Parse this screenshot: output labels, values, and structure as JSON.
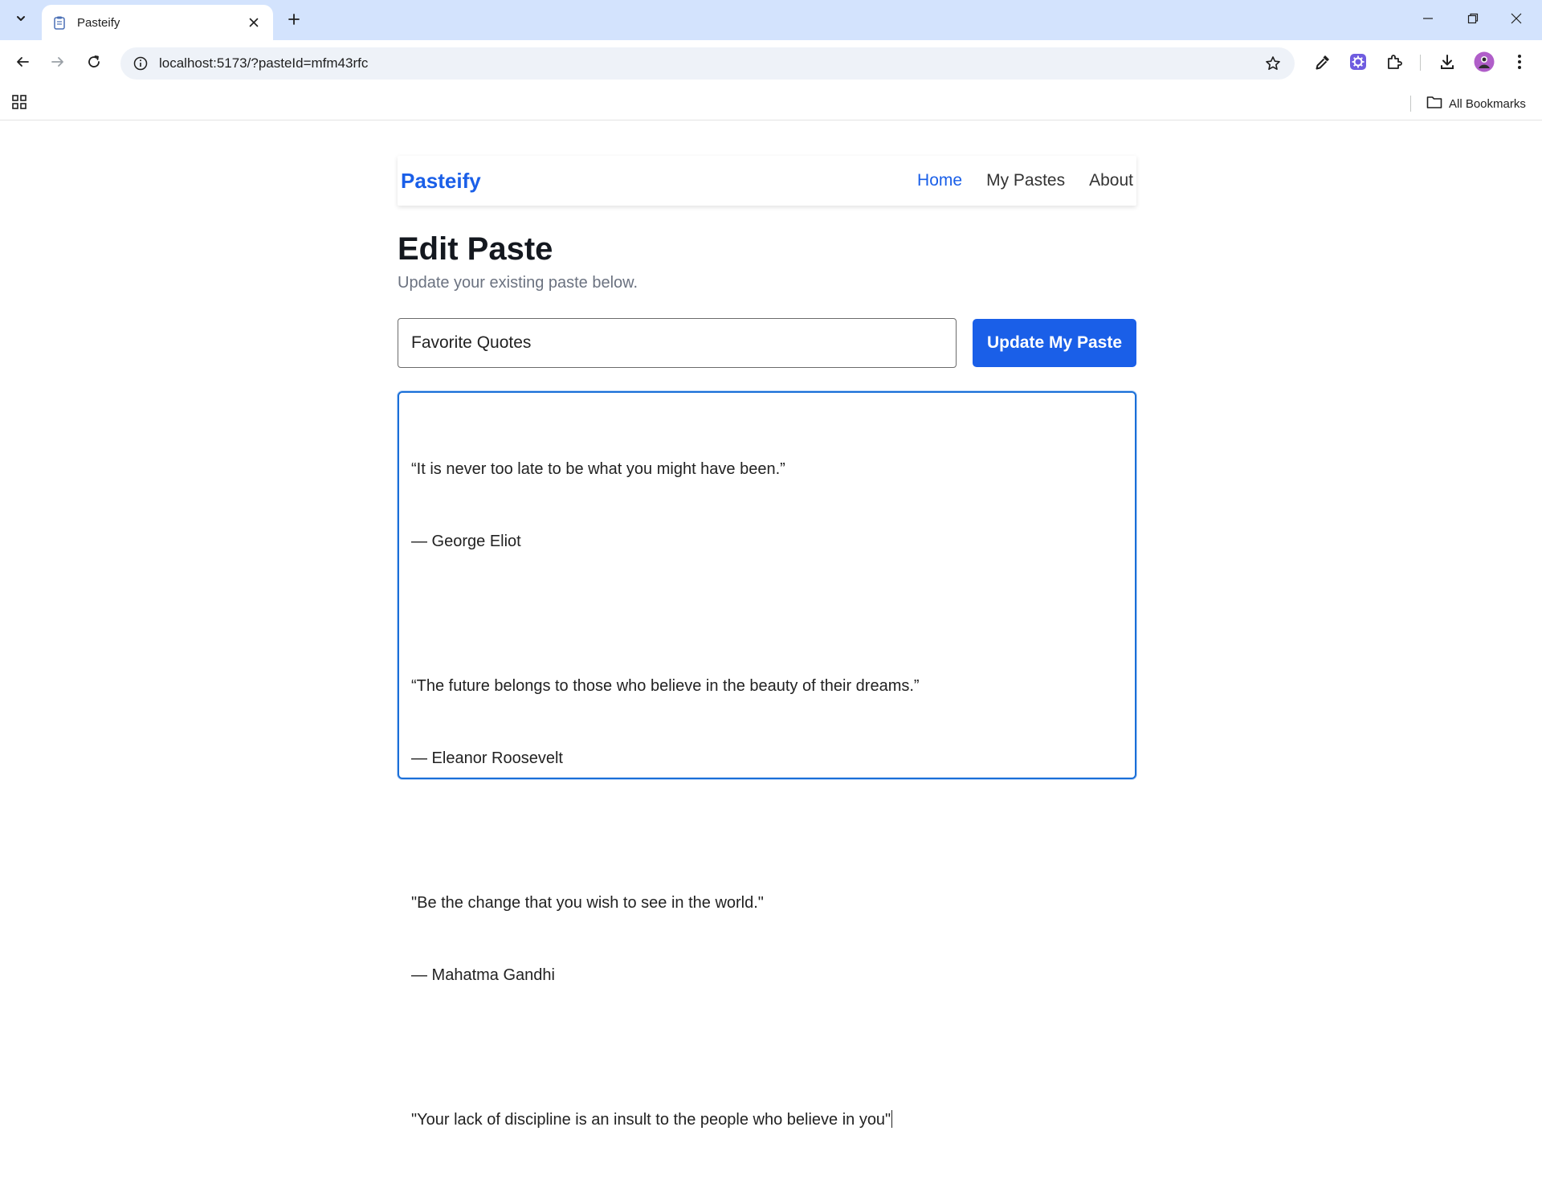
{
  "browser": {
    "tab_title": "Pasteify",
    "url": "localhost:5173/?pasteId=mfm43rfc",
    "all_bookmarks_label": "All Bookmarks",
    "accent_color": "#d3e3fd"
  },
  "app": {
    "brand": "Pasteify",
    "brand_color": "#1a5fe8",
    "nav": {
      "home": "Home",
      "my_pastes": "My Pastes",
      "about": "About"
    },
    "page_title": "Edit Paste",
    "page_subtitle": "Update your existing paste below.",
    "title_input_value": "Favorite Quotes",
    "update_button_label": "Update My Paste",
    "content_lines": [
      "“It is never too late to be what you might have been.”",
      "— George Eliot",
      "",
      "“The future belongs to those who believe in the beauty of their dreams.”",
      "— Eleanor Roosevelt",
      "",
      "\"Be the change that you wish to see in the world.\"",
      "— Mahatma Gandhi",
      "",
      "\"Your lack of discipline is an insult to the people who believe in you\""
    ]
  }
}
